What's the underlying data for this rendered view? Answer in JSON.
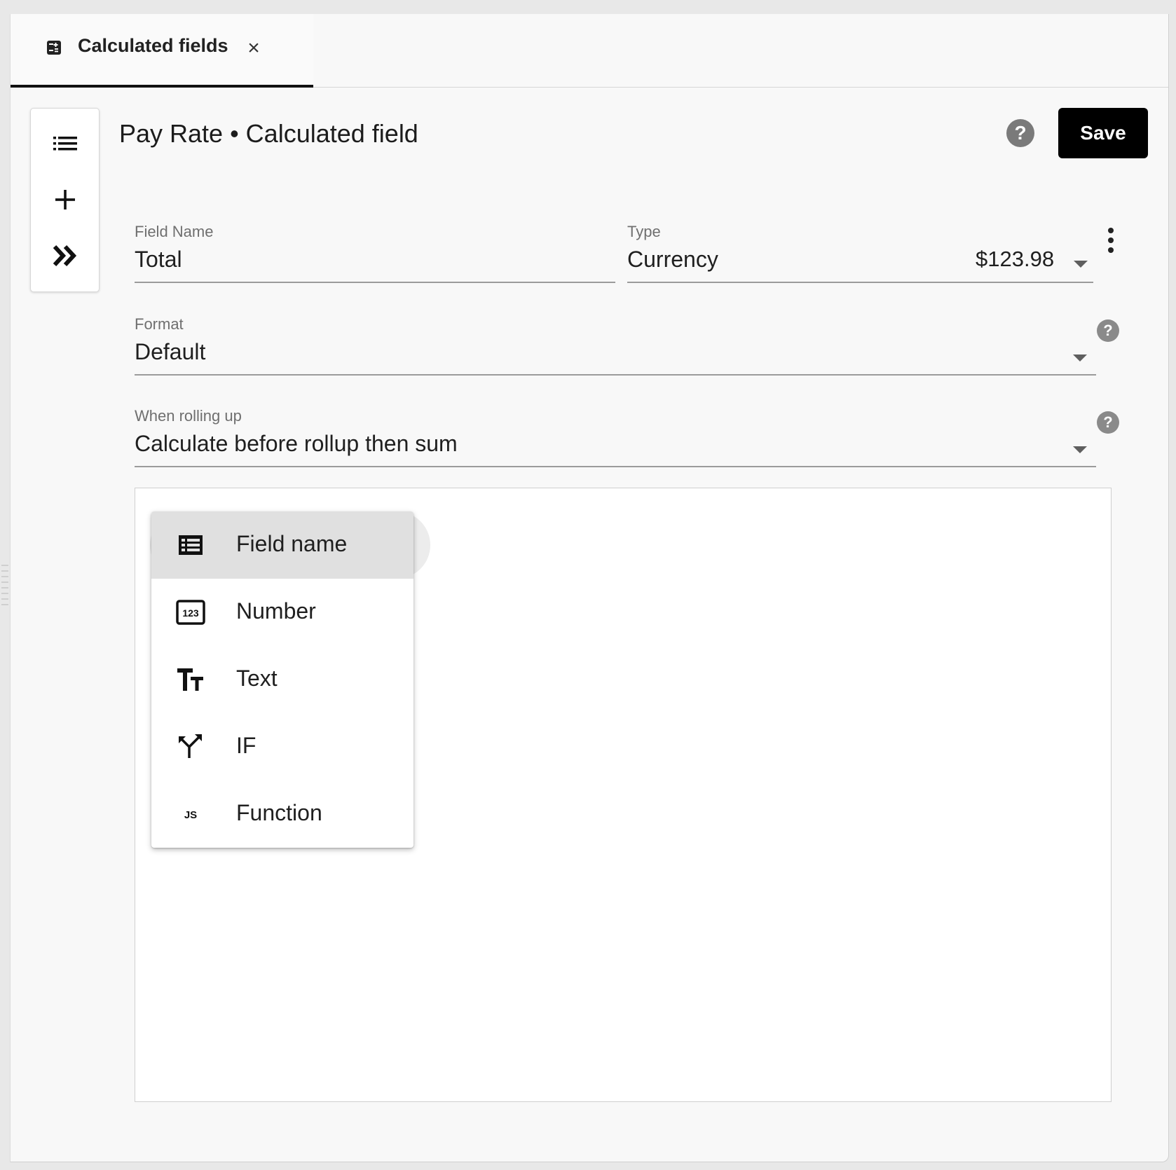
{
  "tab": {
    "label": "Calculated fields",
    "close": "×"
  },
  "toolbar": {
    "list_icon": "list-icon",
    "add_icon": "plus-icon",
    "expand_icon": "double-chevron-right-icon"
  },
  "header": {
    "title": "Pay Rate • Calculated field",
    "help": "?",
    "save_label": "Save"
  },
  "form": {
    "field_name": {
      "label": "Field Name",
      "value": "Total"
    },
    "type": {
      "label": "Type",
      "value": "Currency",
      "preview": "$123.98"
    },
    "format": {
      "label": "Format",
      "value": "Default",
      "help": "?"
    },
    "rollup": {
      "label": "When rolling up",
      "value": "Calculate before rollup then sum",
      "help": "?"
    }
  },
  "menu": {
    "items": [
      {
        "label": "Field name",
        "icon": "table-list-icon",
        "active": true
      },
      {
        "label": "Number",
        "icon": "number-123-icon",
        "active": false
      },
      {
        "label": "Text",
        "icon": "text-size-icon",
        "active": false
      },
      {
        "label": "IF",
        "icon": "branch-split-icon",
        "active": false
      },
      {
        "label": "Function",
        "icon": "js-icon",
        "active": false
      }
    ]
  }
}
